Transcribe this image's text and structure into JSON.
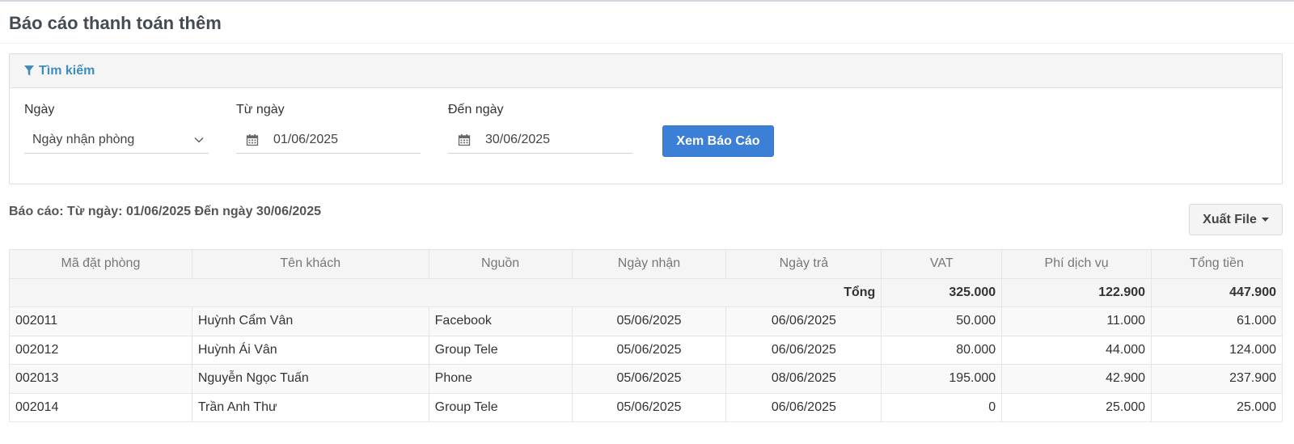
{
  "page": {
    "title": "Báo cáo thanh toán thêm"
  },
  "search": {
    "header": "Tìm kiếm",
    "date_type": {
      "label": "Ngày",
      "value": "Ngày nhận phòng"
    },
    "from_date": {
      "label": "Từ ngày",
      "value": "01/06/2025"
    },
    "to_date": {
      "label": "Đến ngày",
      "value": "30/06/2025"
    },
    "submit_label": "Xem Báo Cáo"
  },
  "report": {
    "caption": "Báo cáo: Từ ngày: 01/06/2025 Đến ngày 30/06/2025",
    "export_label": "Xuất File"
  },
  "table": {
    "headers": [
      "Mã đặt phòng",
      "Tên khách",
      "Nguồn",
      "Ngày nhận",
      "Ngày trả",
      "VAT",
      "Phí dịch vụ",
      "Tổng tiền"
    ],
    "total": {
      "label": "Tổng",
      "vat": "325.000",
      "service_fee": "122.900",
      "grand_total": "447.900"
    },
    "rows": [
      {
        "code": "002011",
        "guest": "Huỳnh Cẩm Vân",
        "source": "Facebook",
        "checkin": "05/06/2025",
        "checkout": "06/06/2025",
        "vat": "50.000",
        "service_fee": "11.000",
        "total": "61.000"
      },
      {
        "code": "002012",
        "guest": "Huỳnh Ái Vân",
        "source": "Group Tele",
        "checkin": "05/06/2025",
        "checkout": "06/06/2025",
        "vat": "80.000",
        "service_fee": "44.000",
        "total": "124.000"
      },
      {
        "code": "002013",
        "guest": "Nguyễn Ngọc Tuấn",
        "source": "Phone",
        "checkin": "05/06/2025",
        "checkout": "08/06/2025",
        "vat": "195.000",
        "service_fee": "42.900",
        "total": "237.900"
      },
      {
        "code": "002014",
        "guest": "Trần Anh Thư",
        "source": "Group Tele",
        "checkin": "05/06/2025",
        "checkout": "06/06/2025",
        "vat": "0",
        "service_fee": "25.000",
        "total": "25.000"
      }
    ]
  },
  "colors": {
    "primary": "#3c7fd6",
    "link": "#3c8dbc",
    "header_bg": "#f5f5f5"
  },
  "icons": [
    "filter-icon",
    "calendar-icon",
    "chevron-down-icon",
    "caret-down-icon"
  ]
}
